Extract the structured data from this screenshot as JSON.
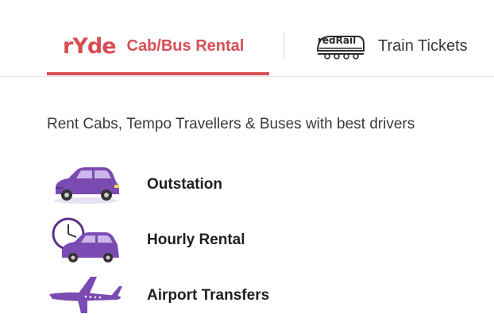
{
  "tabs": [
    {
      "logo": "rYde",
      "label": "Cab/Bus Rental",
      "active": true,
      "icon": "ryde-logo-icon"
    },
    {
      "logo": "redRail",
      "label": "Train Tickets",
      "active": false,
      "icon": "train-icon"
    }
  ],
  "subtitle": "Rent Cabs, Tempo Travellers & Buses with best drivers",
  "services": [
    {
      "label": "Outstation",
      "icon": "car-icon"
    },
    {
      "label": "Hourly Rental",
      "icon": "clock-car-icon"
    },
    {
      "label": "Airport Transfers",
      "icon": "airplane-icon"
    }
  ],
  "colors": {
    "accent": "#d84e55",
    "icon_purple": "#7b4bb3",
    "text": "#1f1f1f"
  }
}
